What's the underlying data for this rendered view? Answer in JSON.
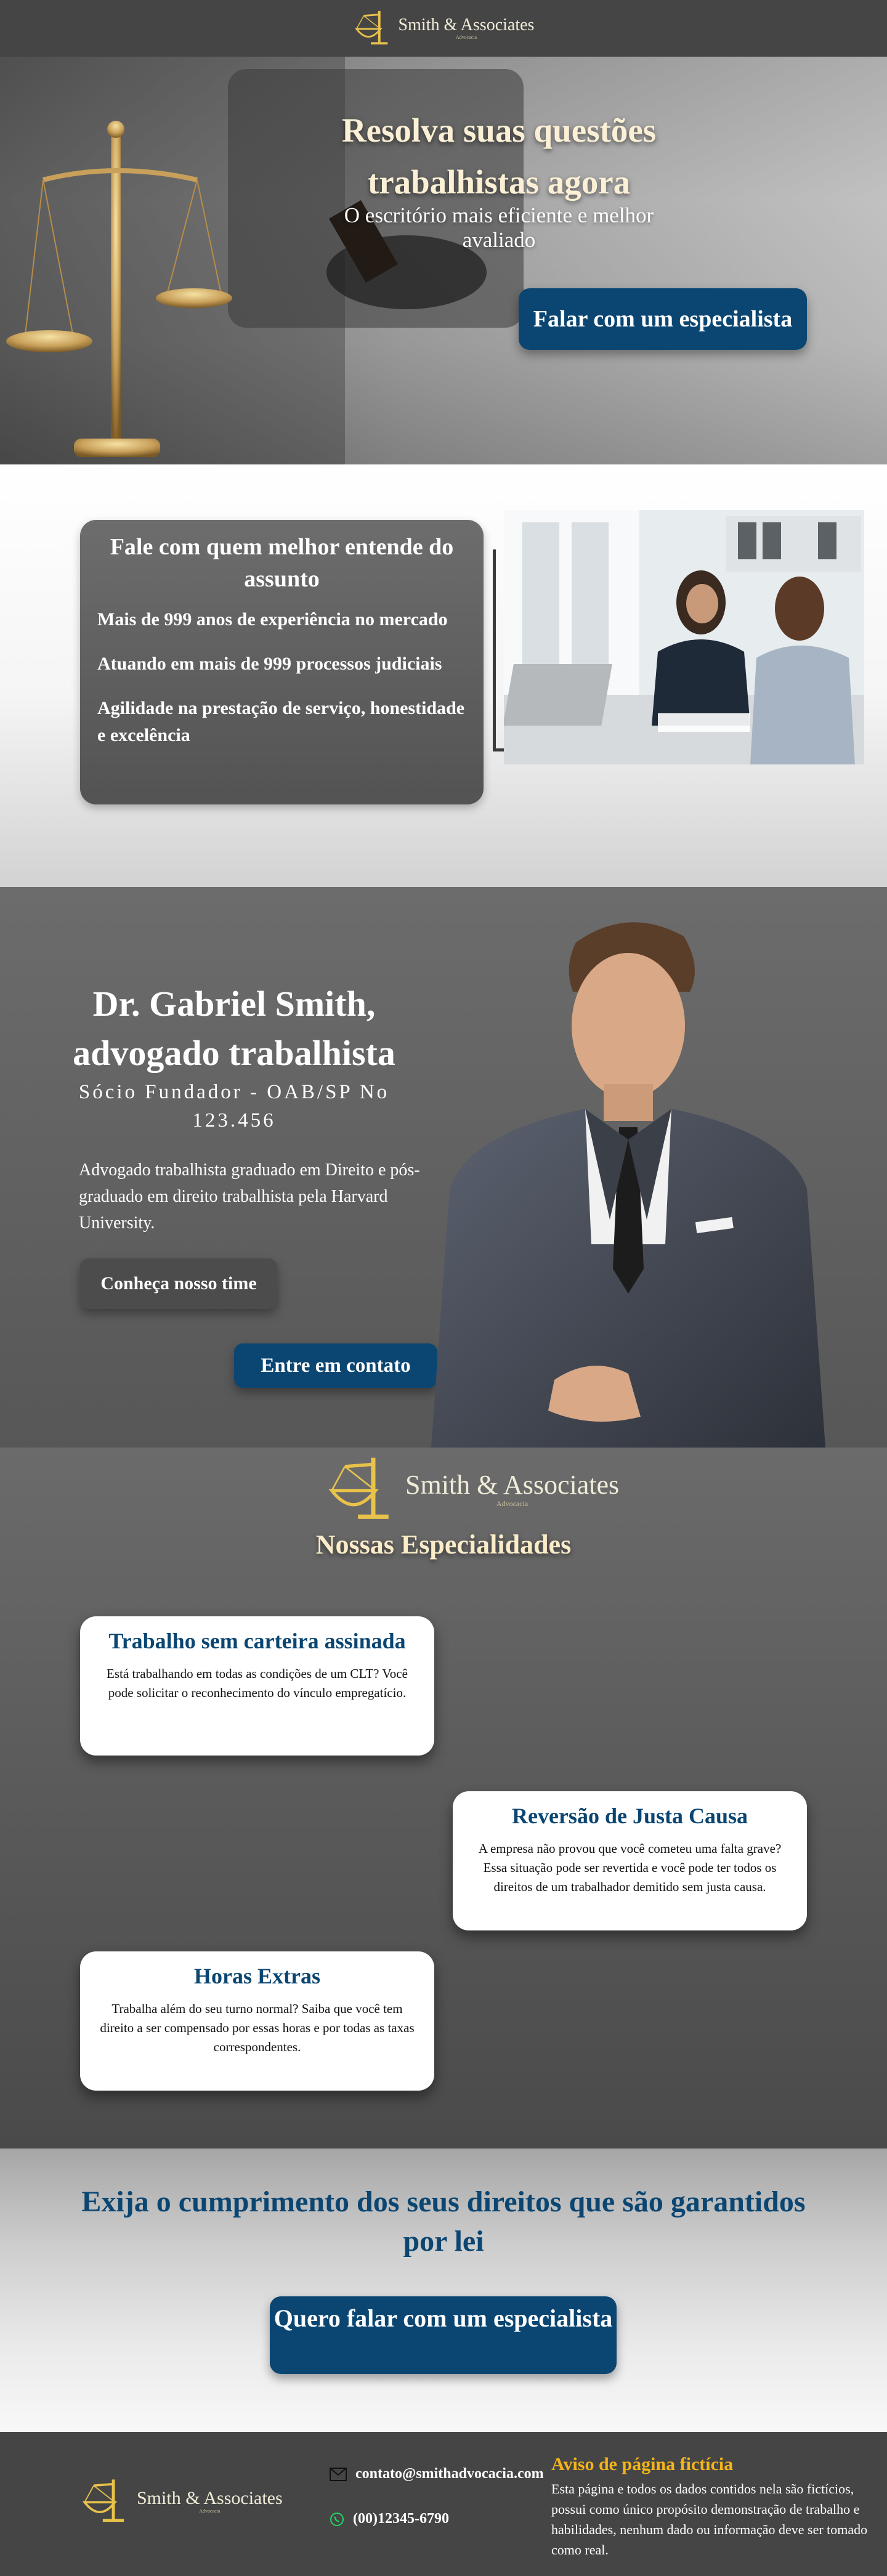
{
  "brand": {
    "name": "Smith & Associates",
    "subtitle": "Advocacia"
  },
  "hero": {
    "title": "Resolva suas questões trabalhistas agora",
    "subtitle": "O escritório mais eficiente e melhor avaliado",
    "button": "Falar com um especialista"
  },
  "about": {
    "title": "Fale com quem melhor entende do assunto",
    "items": [
      "Mais de 999 anos de experiência no mercado",
      "Atuando em mais de 999  processos judiciais",
      "Agilidade na prestação de serviço, honestidade e excelência"
    ]
  },
  "lawyer": {
    "name": "Dr. Gabriel Smith, advogado trabalhista",
    "role": "Sócio Fundador - OAB/SP No 123.456",
    "bio": "Advogado trabalhista graduado em Direito e pós-graduado em direito trabalhista pela Harvard University.",
    "team_button": "Conheça nosso time",
    "contact_button": "Entre em contato"
  },
  "specialties": {
    "title": "Nossas Especialidades",
    "cards": [
      {
        "title": "Trabalho sem carteira assinada",
        "desc": "Está trabalhando em todas as condições de um CLT? Você pode solicitar o reconhecimento do vínculo empregatício."
      },
      {
        "title": "Reversão de Justa Causa",
        "desc": "A empresa não provou que você cometeu uma falta grave? Essa situação pode ser revertida e você pode ter todos os direitos de um trabalhador demitido sem justa causa."
      },
      {
        "title": "Horas Extras",
        "desc": "Trabalha além do seu turno normal? Saiba que você tem direito a ser compensado por essas horas e por todas as taxas correspondentes."
      }
    ]
  },
  "cta": {
    "text": "Exija o cumprimento dos seus direitos que são garantidos por lei",
    "button": "Quero falar com um especialista"
  },
  "footer": {
    "email": "contato@smithadvocacia.com",
    "phone": "(00)12345-6790",
    "notice_title": "Aviso de página fictícia",
    "notice_text": "Esta página e todos os dados contidos nela são fictícios, possui como único propósito demonstração de trabalho e habilidades, nenhum dado ou informação deve ser tomado como real."
  },
  "colors": {
    "navy": "#0b4672",
    "gold": "#e7c04c",
    "dark": "#454545",
    "notice": "#f3b419"
  }
}
